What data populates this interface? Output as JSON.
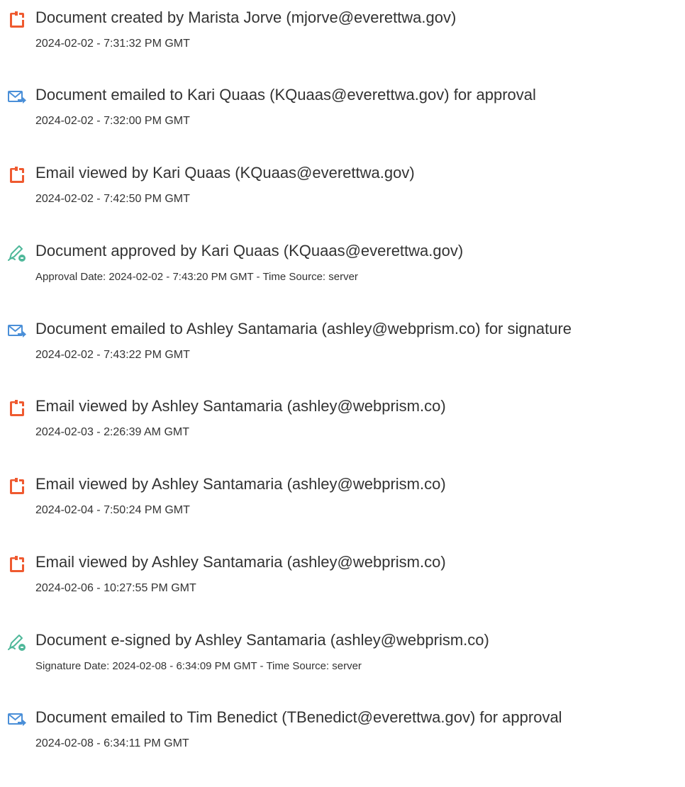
{
  "events": [
    {
      "icon": "document-created-icon",
      "title": "Document created by Marista Jorve (mjorve@everettwa.gov)",
      "time": "2024-02-02 - 7:31:32 PM GMT"
    },
    {
      "icon": "email-sent-icon",
      "title": "Document emailed to Kari Quaas (KQuaas@everettwa.gov) for approval",
      "time": "2024-02-02 - 7:32:00 PM GMT"
    },
    {
      "icon": "document-viewed-icon",
      "title": "Email viewed by Kari Quaas (KQuaas@everettwa.gov)",
      "time": "2024-02-02 - 7:42:50 PM GMT"
    },
    {
      "icon": "pen-signature-icon",
      "title": "Document approved by Kari Quaas (KQuaas@everettwa.gov)",
      "time": "Approval Date: 2024-02-02 - 7:43:20 PM GMT - Time Source: server"
    },
    {
      "icon": "email-sent-icon",
      "title": "Document emailed to Ashley Santamaria (ashley@webprism.co) for signature",
      "time": "2024-02-02 - 7:43:22 PM GMT"
    },
    {
      "icon": "document-viewed-icon",
      "title": "Email viewed by Ashley Santamaria (ashley@webprism.co)",
      "time": "2024-02-03 - 2:26:39 AM GMT"
    },
    {
      "icon": "document-viewed-icon",
      "title": "Email viewed by Ashley Santamaria (ashley@webprism.co)",
      "time": "2024-02-04 - 7:50:24 PM GMT"
    },
    {
      "icon": "document-viewed-icon",
      "title": "Email viewed by Ashley Santamaria (ashley@webprism.co)",
      "time": "2024-02-06 - 10:27:55 PM GMT"
    },
    {
      "icon": "pen-signature-icon",
      "title": "Document e-signed by Ashley Santamaria (ashley@webprism.co)",
      "time": "Signature Date: 2024-02-08 - 6:34:09 PM GMT - Time Source: server"
    },
    {
      "icon": "email-sent-icon",
      "title": "Document emailed to Tim Benedict (TBenedict@everettwa.gov) for approval",
      "time": "2024-02-08 - 6:34:11 PM GMT"
    }
  ],
  "colors": {
    "document_icon": "#ef5a30",
    "email_icon": "#4a8fd8",
    "pen_icon": "#4fb89a",
    "text": "#333333"
  }
}
